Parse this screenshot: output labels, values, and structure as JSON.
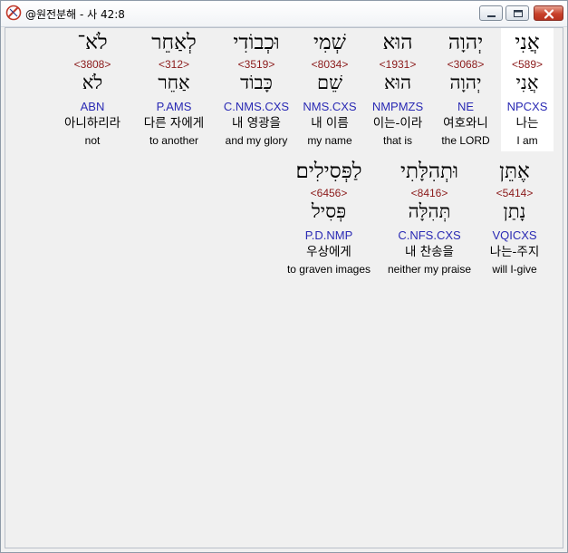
{
  "window": {
    "title": "@원전분해 - 사 42:8"
  },
  "icons": {
    "app": "app-logo-icon",
    "minimize": "minimize-icon",
    "maximize": "maximize-icon",
    "close": "close-icon"
  },
  "colors": {
    "strong_number": "#8b1a1a",
    "parsing_code": "#2a2ab4",
    "selected_bg": "#ffffff",
    "close_button": "#c8412b"
  },
  "rows": [
    {
      "words": [
        {
          "hebrew": "אֲנִי",
          "strong": "<589>",
          "lemma": "אֲנִי",
          "parsing": "NPCXS",
          "korean": "나는",
          "english": "I am",
          "selected": true
        },
        {
          "hebrew": "יְהוָה",
          "strong": "<3068>",
          "lemma": "יְהוָה",
          "parsing": "NE",
          "korean": "여호와니",
          "english": "the LORD"
        },
        {
          "hebrew": "הוּא",
          "strong": "<1931>",
          "lemma": "הוּא",
          "parsing": "NMPMZS",
          "korean": "이는-이라",
          "english": "that is"
        },
        {
          "hebrew": "שְׁמִי",
          "strong": "<8034>",
          "lemma": "שֵׁם",
          "parsing": "NMS.CXS",
          "korean": "내 이름",
          "english": "my name"
        },
        {
          "hebrew": "וּכְבוֹדִי",
          "strong": "<3519>",
          "lemma": "כָּבוֹד",
          "parsing": "C.NMS.CXS",
          "korean": "내 영광을",
          "english": "and my glory"
        },
        {
          "hebrew": "לְאַחֵר",
          "strong": "<312>",
          "lemma": "אַחֵר",
          "parsing": "P.AMS",
          "korean": "다른 자에게",
          "english": "to another"
        },
        {
          "hebrew": "לֹא־",
          "strong": "<3808>",
          "lemma": "לֹא",
          "parsing": "ABN",
          "korean": "아니하리라",
          "english": "not"
        }
      ]
    },
    {
      "words": [
        {
          "hebrew": "אֶתֵּן",
          "strong": "<5414>",
          "lemma": "נָתַן",
          "parsing": "VQICXS",
          "korean": "나는-주지",
          "english": "will I-give"
        },
        {
          "hebrew": "וּתְהִלָּתִי",
          "strong": "<8416>",
          "lemma": "תְּהִלָּה",
          "parsing": "C.NFS.CXS",
          "korean": "내 찬송을",
          "english": "neither my praise"
        },
        {
          "hebrew": "לַפְּסִילִים׃",
          "strong": "<6456>",
          "lemma": "פְּסִיל",
          "parsing": "P.D.NMP",
          "korean": "우상에게",
          "english": "to graven images"
        }
      ]
    }
  ]
}
